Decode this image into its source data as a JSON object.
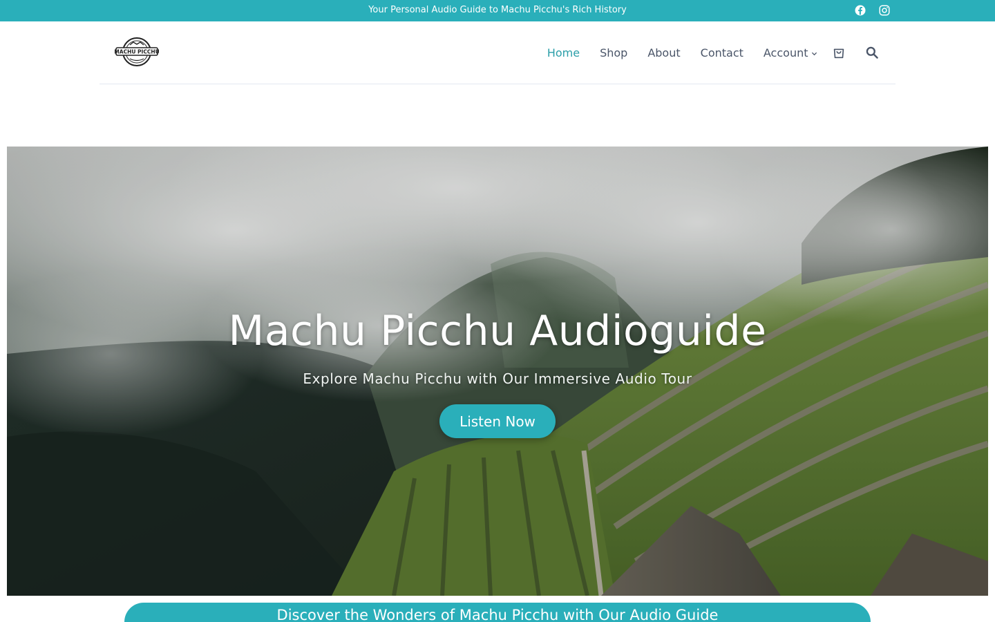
{
  "topbar": {
    "tagline": "Your Personal Audio Guide to Machu Picchu's Rich History",
    "social": [
      {
        "icon": "facebook-icon"
      },
      {
        "icon": "instagram-icon"
      }
    ]
  },
  "header": {
    "logo_text": "MACHU PICCHU",
    "nav": [
      {
        "label": "Home",
        "active": true
      },
      {
        "label": "Shop"
      },
      {
        "label": "About"
      },
      {
        "label": "Contact"
      },
      {
        "label": "Account"
      }
    ],
    "icons": [
      "chevron-down-icon",
      "cart-icon",
      "search-icon"
    ]
  },
  "hero": {
    "title": "Machu Picchu Audioguide",
    "subtitle": "Explore Machu Picchu with Our Immersive Audio Tour",
    "cta_label": "Listen Now"
  },
  "banner": {
    "heading": "Discover the Wonders of Machu Picchu with Our Audio Guide"
  },
  "colors": {
    "accent": "#2aafba",
    "nav_active": "#2a9ea8",
    "nav_text": "#4a5568"
  }
}
